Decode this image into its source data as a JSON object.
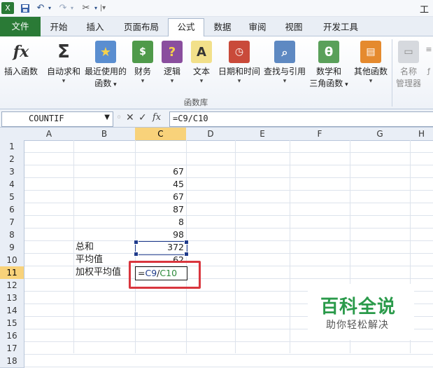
{
  "window": {
    "title": "工"
  },
  "quick_access": {
    "save_icon": "save-icon",
    "undo_icon": "undo-icon",
    "redo_icon": "redo-icon",
    "customize_icon": "tools-icon"
  },
  "tabs": [
    {
      "label": "文件"
    },
    {
      "label": "开始"
    },
    {
      "label": "插入"
    },
    {
      "label": "页面布局"
    },
    {
      "label": "公式"
    },
    {
      "label": "数据"
    },
    {
      "label": "审阅"
    },
    {
      "label": "视图"
    },
    {
      "label": "开发工具"
    }
  ],
  "ribbon": {
    "insert_function": "插入函数",
    "autosum": "自动求和",
    "recent_1": "最近使用的",
    "recent_2": "函数",
    "financial": "财务",
    "logical": "逻辑",
    "text": "文本",
    "datetime": "日期和时间",
    "lookup": "查找与引用",
    "math_1": "数学和",
    "math_2": "三角函数",
    "more": "其他函数",
    "name_mgr_1": "名称",
    "name_mgr_2": "管理器",
    "group_label": "函数库",
    "fx_symbol": "fx",
    "sigma_symbol": "Σ",
    "theta_symbol": "θ"
  },
  "formula_bar": {
    "name_box": "COUNTIF",
    "formula": "=C9/C10",
    "cancel_glyph": "✕",
    "enter_glyph": "✓",
    "fx_glyph": "fx"
  },
  "sheet": {
    "columns": [
      "A",
      "B",
      "C",
      "D",
      "E",
      "F",
      "G",
      "H"
    ],
    "active_column": "C",
    "rows": [
      "1",
      "2",
      "3",
      "4",
      "5",
      "6",
      "7",
      "8",
      "9",
      "10",
      "11",
      "12",
      "13",
      "14",
      "15",
      "16",
      "17",
      "18"
    ],
    "active_row": "11",
    "c_values": {
      "3": "67",
      "4": "45",
      "5": "67",
      "6": "87",
      "7": "8",
      "8": "98",
      "9": "372",
      "10": "62"
    },
    "b_labels": {
      "9": "总和",
      "10": "平均值",
      "11": "加权平均值"
    },
    "editing": {
      "prefix": "=",
      "ref1": "C9",
      "slash": "/",
      "ref2": "C10"
    }
  },
  "watermark": {
    "title": "百科全说",
    "subtitle": "助你轻松解决"
  },
  "colors": {
    "file_tab": "#2a7a36",
    "highlight_red": "#d9363e",
    "ref_blue": "#1f3b8c",
    "ref_green": "#2c8a3a"
  }
}
